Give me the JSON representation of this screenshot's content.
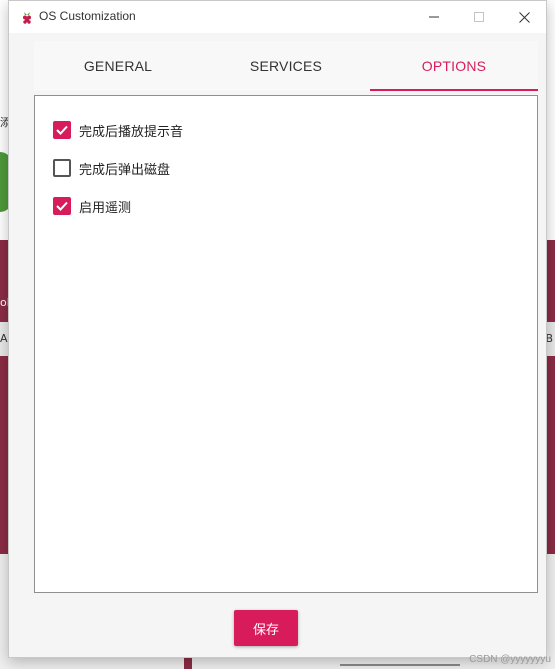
{
  "window": {
    "title": "OS Customization"
  },
  "tabs": [
    {
      "label": "GENERAL",
      "active": false
    },
    {
      "label": "SERVICES",
      "active": false
    },
    {
      "label": "OPTIONS",
      "active": true
    }
  ],
  "options": [
    {
      "label": "完成后播放提示音",
      "checked": true
    },
    {
      "label": "完成后弹出磁盘",
      "checked": false
    },
    {
      "label": "启用遥测",
      "checked": true
    }
  ],
  "save_button": {
    "label": "保存"
  },
  "watermark": "CSDN @yyyyyyyu",
  "colors": {
    "accent": "#d81c5b",
    "background_app": "#8c2c46"
  },
  "background_fragments": {
    "left_top": "添",
    "left_mid": "ob",
    "left_bar": "AS",
    "right_bar": "B"
  }
}
